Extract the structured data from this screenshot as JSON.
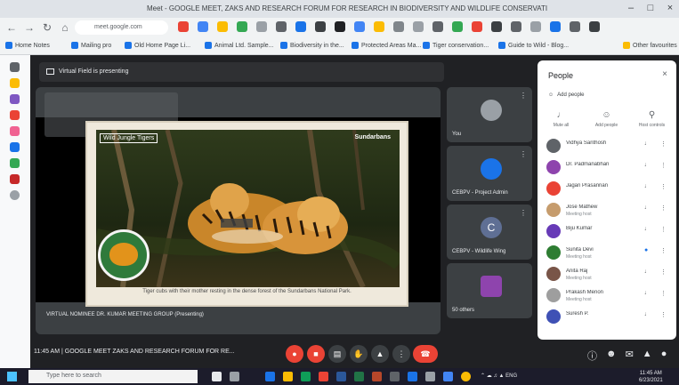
{
  "browser": {
    "window_title": "Meet - GOOGLE MEET, ZAKS AND RESEARCH FORUM FOR RESEARCH IN BIODIVERSITY AND WILDLIFE CONSERVATION - SUMMER LEARNING LINE",
    "url": "meet.google.com",
    "bookmarks": [
      "Home Notes",
      "Mailing pro",
      "Old Home Page Li...",
      "Animal Ltd. Sample...",
      "Biodiversity in the...",
      "Protected Areas Ma...",
      "Tiger conservation...",
      "Guide to Wild - Blog...",
      "Other favourites"
    ]
  },
  "meet": {
    "presenting_banner": "Virtual Field is presenting",
    "slide": {
      "photo_tag": "Wild Jungle Tigers",
      "brand_watermark": "Sundarbans",
      "caption": "Tiger cubs with their mother resting in the dense forest of the Sundarbans National Park."
    },
    "presenter_label": "VIRTUAL NOMINEE DR. KUMAR MEETING GROUP (Presenting)",
    "tiles": [
      {
        "name": "You",
        "initial": ""
      },
      {
        "name": "CEBPV - Project Admin",
        "initial": ""
      },
      {
        "name": "CEBPV - Wildlife Wing",
        "initial": "C"
      },
      {
        "name": "50 others",
        "initial": ""
      }
    ],
    "meeting_info": "11:45 AM  |  GOOGLE MEET ZAKS AND RESEARCH FORUM FOR RE...",
    "controls": [
      "mic-off",
      "cam-off",
      "captions",
      "raise-hand",
      "present",
      "more",
      "leave"
    ]
  },
  "people_panel": {
    "title": "People",
    "add_people": "Add people",
    "options": [
      "Mute all",
      "Add people",
      "Host controls"
    ],
    "participants": [
      {
        "name": "Vidhya Santhosh",
        "sub": "",
        "color": "#5f6368"
      },
      {
        "name": "Dr. Padmanabhan",
        "sub": "",
        "color": "#8e44ad"
      },
      {
        "name": "Jagan Prasannan",
        "sub": "",
        "color": "#ea4335"
      },
      {
        "name": "Jose Mathew",
        "sub": "Meeting host",
        "color": "#c69c6d"
      },
      {
        "name": "Biju Kumar",
        "sub": "",
        "color": "#673ab7"
      },
      {
        "name": "Sunita Devi",
        "sub": "Meeting host",
        "color": "#2e7d32"
      },
      {
        "name": "Anita Raj",
        "sub": "Meeting host",
        "color": "#795548"
      },
      {
        "name": "Prakash Menon",
        "sub": "Meeting host",
        "color": "#9e9e9e"
      },
      {
        "name": "Suresh P.",
        "sub": "",
        "color": "#3f51b5"
      }
    ]
  },
  "taskbar": {
    "search_placeholder": "Type here to search",
    "time": "11:45 AM",
    "date": "6/23/2021"
  }
}
